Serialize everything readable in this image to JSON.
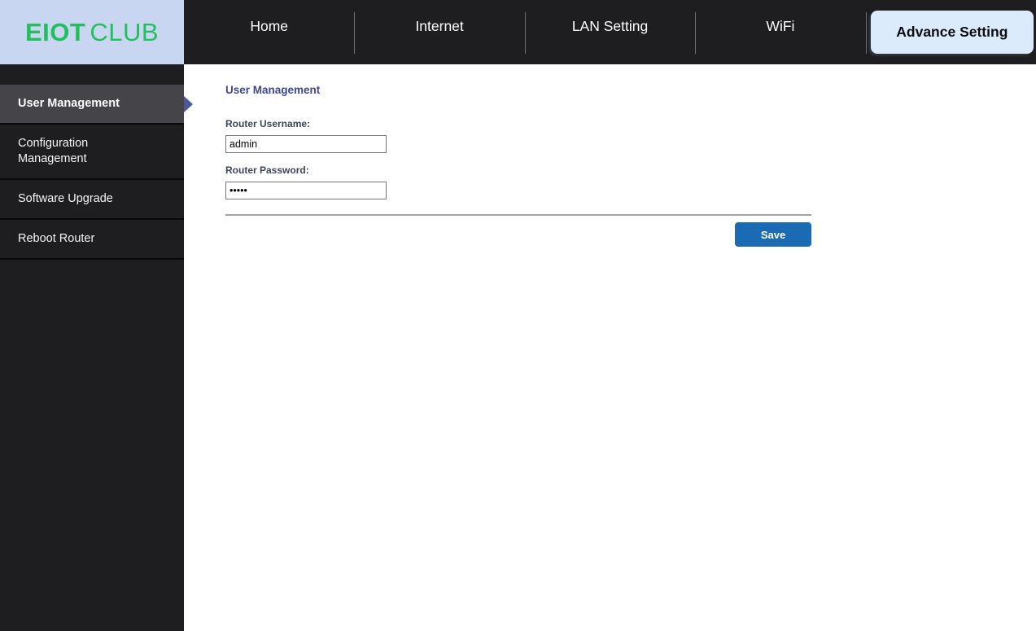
{
  "brand": {
    "name_primary": "EIOT",
    "name_secondary": "CLUB"
  },
  "nav": {
    "items": [
      {
        "label": "Home",
        "active": false
      },
      {
        "label": "Internet",
        "active": false
      },
      {
        "label": "LAN Setting",
        "active": false
      },
      {
        "label": "WiFi",
        "active": false
      },
      {
        "label": "Advance Setting",
        "active": true
      }
    ]
  },
  "sidebar": {
    "items": [
      {
        "label": "User Management",
        "active": true
      },
      {
        "label": "Configuration Management",
        "active": false
      },
      {
        "label": "Software Upgrade",
        "active": false
      },
      {
        "label": "Reboot Router",
        "active": false
      }
    ]
  },
  "main": {
    "title": "User Management",
    "form": {
      "username_label": "Router Username:",
      "username_value": "admin",
      "password_label": "Router Password:",
      "password_masked_value": "•••••"
    },
    "save_label": "Save"
  },
  "colors": {
    "brand-green": "#21c05c",
    "logo-bg": "#c9d6f2",
    "dark": "#1e1e20",
    "active-tab-bg": "#dcebfb",
    "sidebar-active-bg": "#454549",
    "arrow-blue": "#4e5993",
    "heading-blue": "#3c4894",
    "label-slate": "#3d4554",
    "save-blue": "#1a6bb4"
  }
}
